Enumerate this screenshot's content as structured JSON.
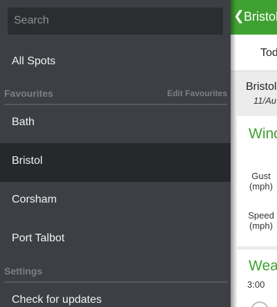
{
  "menu": {
    "search_placeholder": "Search",
    "all_spots": "All Spots",
    "favourites_header": "Favourites",
    "edit_favourites": "Edit Favourites",
    "favourites": [
      "Bath",
      "Bristol",
      "Corsham",
      "Port Talbot"
    ],
    "selected_favourite": "Bristol",
    "settings_header": "Settings",
    "check_updates": "Check for updates"
  },
  "detail": {
    "title": "Bristol",
    "tab": "Today",
    "location_name": "Bristol",
    "date": "11/Au",
    "wind_title": "Wind",
    "gust_label": "Gust\n(mph)",
    "speed_label": "Speed\n(mph)",
    "weather_title": "Weather",
    "time": "3:00"
  },
  "colors": {
    "accent": "#3fa132",
    "menu_bg": "#3c3f43",
    "selected_bg": "#26282b"
  }
}
